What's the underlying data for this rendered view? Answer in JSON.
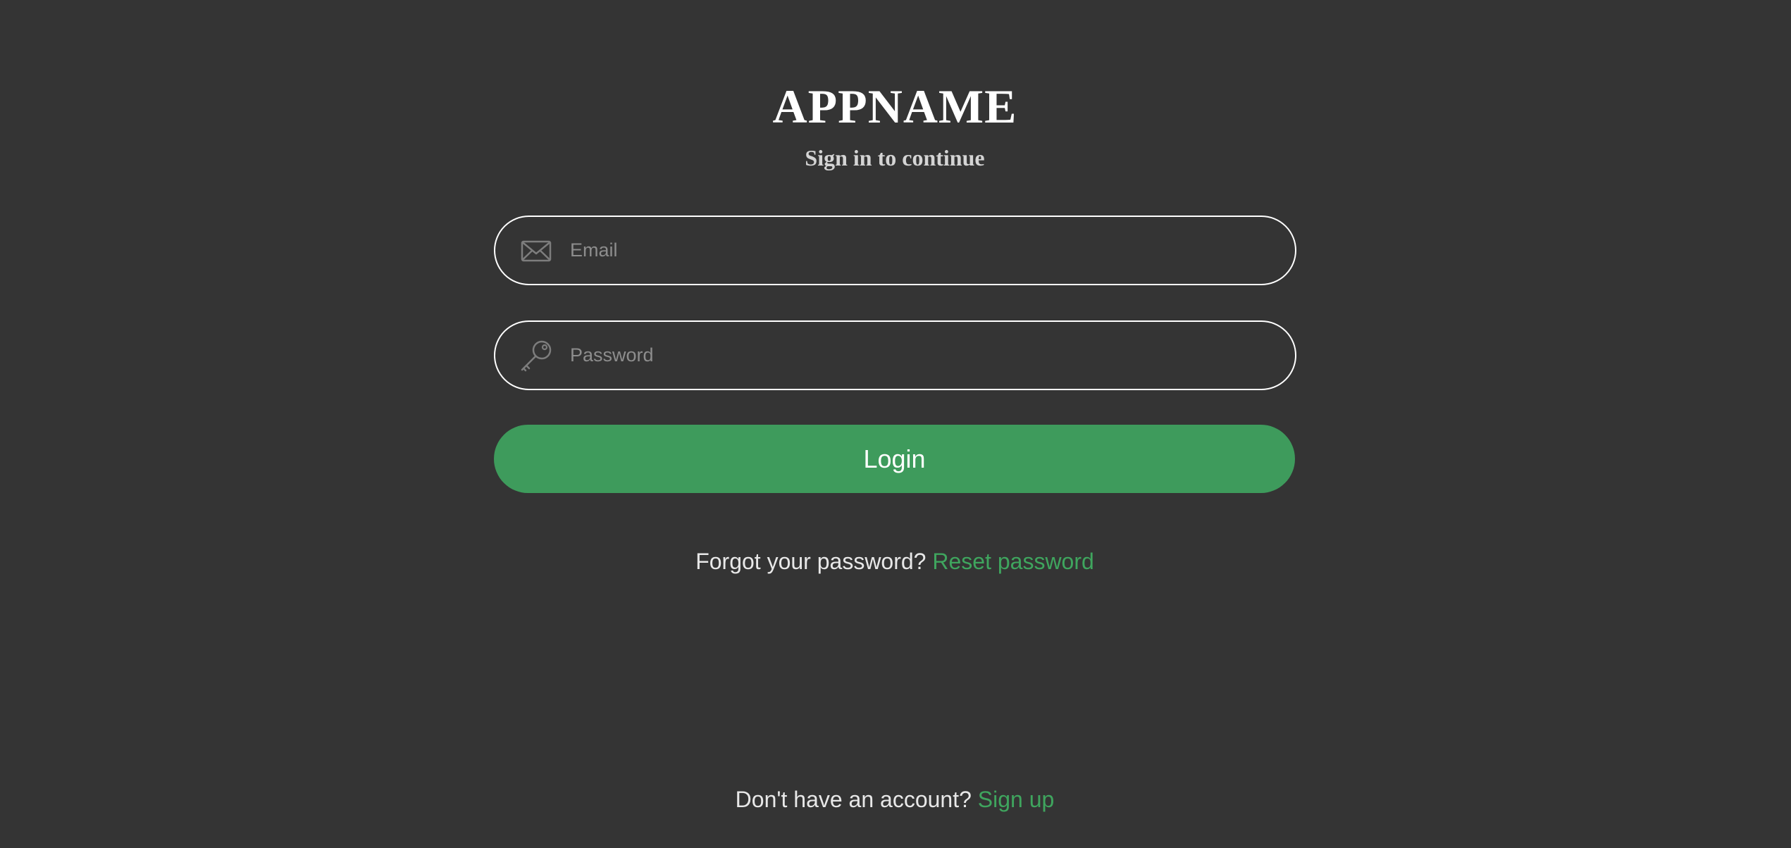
{
  "header": {
    "app_name": "APPNAME",
    "subtitle": "Sign in to continue"
  },
  "form": {
    "email": {
      "placeholder": "Email",
      "value": "",
      "icon": "envelope-icon"
    },
    "password": {
      "placeholder": "Password",
      "value": "",
      "icon": "key-icon"
    },
    "login_label": "Login"
  },
  "forgot": {
    "prompt": "Forgot your password?",
    "link_label": "Reset password"
  },
  "signup": {
    "prompt": "Don't have an account?",
    "link_label": "Sign up"
  },
  "colors": {
    "background": "#343434",
    "accent": "#3e9b5c",
    "link": "#3fa55e",
    "field_border": "#ffffff",
    "placeholder": "#8d8d8d"
  }
}
